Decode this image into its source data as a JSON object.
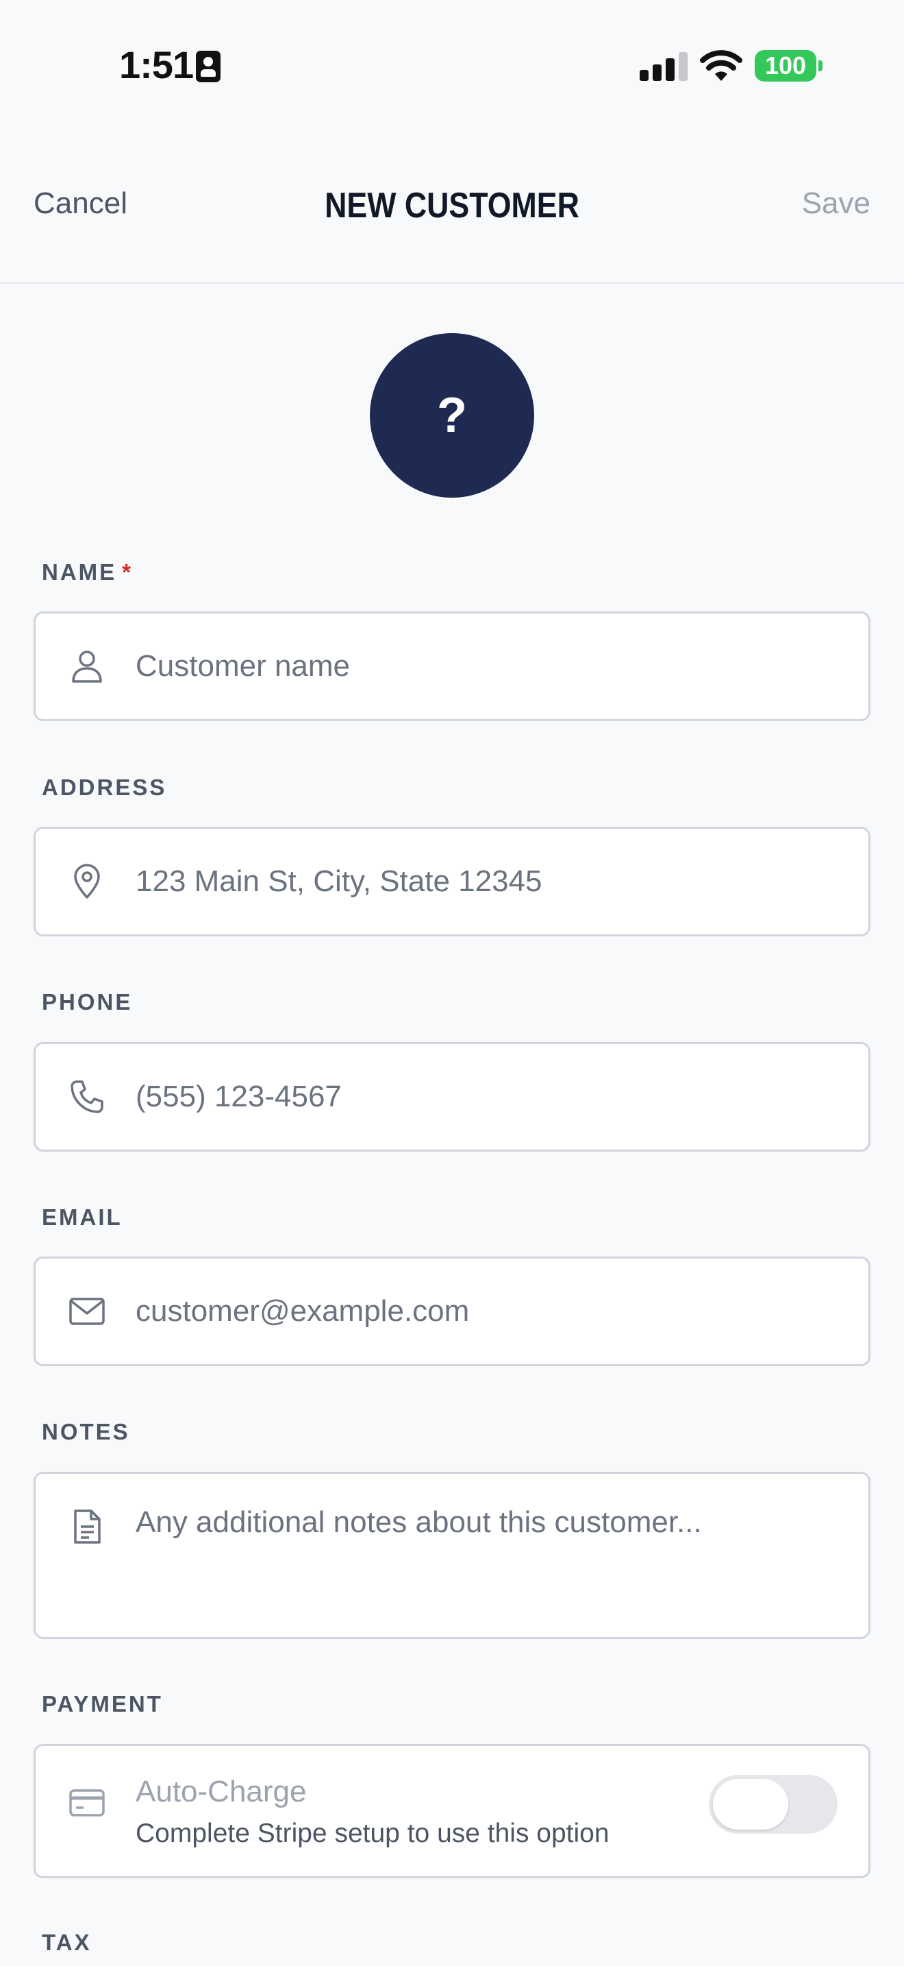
{
  "status_bar": {
    "time": "1:51",
    "battery": "100"
  },
  "nav": {
    "cancel": "Cancel",
    "title": "NEW CUSTOMER",
    "save": "Save"
  },
  "avatar": {
    "placeholder": "?"
  },
  "form": {
    "name": {
      "label": "NAME",
      "required_mark": "*",
      "placeholder": "Customer name"
    },
    "address": {
      "label": "ADDRESS",
      "placeholder": "123 Main St, City, State 12345"
    },
    "phone": {
      "label": "PHONE",
      "placeholder": "(555) 123-4567"
    },
    "email": {
      "label": "EMAIL",
      "placeholder": "customer@example.com"
    },
    "notes": {
      "label": "NOTES",
      "placeholder": "Any additional notes about this customer..."
    },
    "payment": {
      "label": "PAYMENT",
      "auto_charge_title": "Auto-Charge",
      "auto_charge_subtitle": "Complete Stripe setup to use this option",
      "auto_charge_enabled": false
    },
    "tax": {
      "label": "TAX"
    }
  },
  "colors": {
    "avatar_bg": "#1e2a52",
    "battery": "#34c759",
    "required": "#dc2626",
    "background": "#f8f9fb"
  },
  "icons": [
    "person-icon",
    "location-pin-icon",
    "phone-icon",
    "envelope-icon",
    "document-icon",
    "credit-card-icon"
  ]
}
